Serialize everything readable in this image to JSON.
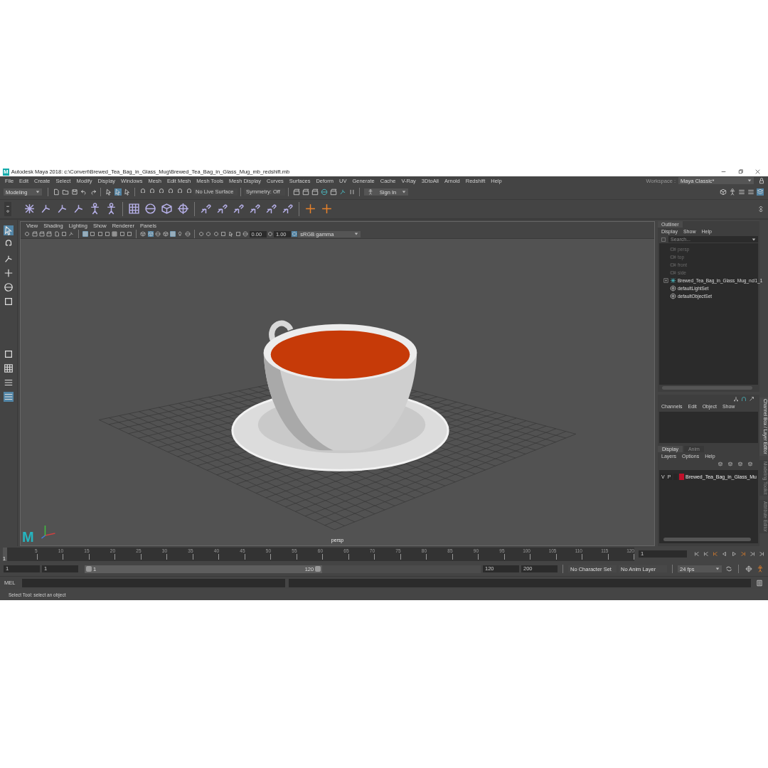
{
  "window": {
    "app_icon": "M",
    "title": "Autodesk Maya 2018: c:\\Convert\\Brewed_Tea_Bag_in_Glass_Mug\\Brewed_Tea_Bag_in_Glass_Mug_mb_redshift.mb"
  },
  "menu": [
    "File",
    "Edit",
    "Create",
    "Select",
    "Modify",
    "Display",
    "Windows",
    "Mesh",
    "Edit Mesh",
    "Mesh Tools",
    "Mesh Display",
    "Curves",
    "Surfaces",
    "Deform",
    "UV",
    "Generate",
    "Cache",
    "V-Ray",
    "3DtoAll",
    "Arnold",
    "Redshift",
    "Help"
  ],
  "workspace": {
    "label": "Workspace :",
    "value": "Maya Classic*"
  },
  "status_line": {
    "mode": "Modeling",
    "live_surface": "No Live Surface",
    "symmetry": "Symmetry: Off",
    "sign_in": "Sign In"
  },
  "viewport": {
    "menu": [
      "View",
      "Shading",
      "Lighting",
      "Show",
      "Renderer",
      "Panels"
    ],
    "exposure": "0.00",
    "gamma": "1.00",
    "color_space": "sRGB gamma",
    "camera_label": "persp",
    "logo": "M"
  },
  "outliner": {
    "title": "Outliner",
    "menu": [
      "Display",
      "Show",
      "Help"
    ],
    "search": {
      "placeholder": "Search..."
    },
    "items": [
      {
        "name": "persp",
        "kind": "camera",
        "hidden": true
      },
      {
        "name": "top",
        "kind": "camera",
        "hidden": true
      },
      {
        "name": "front",
        "kind": "camera",
        "hidden": true
      },
      {
        "name": "side",
        "kind": "camera",
        "hidden": true
      },
      {
        "name": "Brewed_Tea_Bag_in_Glass_Mug_ncl1_1",
        "kind": "group",
        "hidden": false,
        "expanded": false
      },
      {
        "name": "defaultLightSet",
        "kind": "set",
        "hidden": false
      },
      {
        "name": "defaultObjectSet",
        "kind": "set",
        "hidden": false
      }
    ]
  },
  "channel_box": {
    "menu": [
      "Channels",
      "Edit",
      "Object",
      "Show"
    ]
  },
  "layer_editor": {
    "tabs": [
      {
        "label": "Display",
        "selected": true
      },
      {
        "label": "Anim",
        "selected": false
      }
    ],
    "menu": [
      "Layers",
      "Options",
      "Help"
    ],
    "layers": [
      {
        "visible": "V",
        "playback": "P",
        "color": "#c0102a",
        "name": "Brewed_Tea_Bag_in_Glass_Mu"
      }
    ]
  },
  "side_tabs": [
    {
      "label": "Channel Box / Layer Editor",
      "selected": true
    },
    {
      "label": "Modeling Toolkit",
      "selected": false
    },
    {
      "label": "Attribute Editor",
      "selected": false
    }
  ],
  "timeline": {
    "current_frame": "1",
    "level": 0,
    "ticks": [
      "5",
      "10",
      "15",
      "20",
      "25",
      "30",
      "35",
      "40",
      "45",
      "50",
      "55",
      "60",
      "65",
      "70",
      "75",
      "80",
      "85",
      "90",
      "95",
      "100",
      "105",
      "110",
      "115",
      "120"
    ],
    "frame_field": "1"
  },
  "range": {
    "level": 0.6,
    "start": "1",
    "playback_start": "1",
    "slider_start": "1",
    "slider_end": "120",
    "playback_end": "120",
    "end": "200",
    "character_set": "No Character Set",
    "anim_layer": "No Anim Layer",
    "fps": "24 fps"
  },
  "command_line": {
    "label": "MEL"
  },
  "help_line": "Select Tool: select an object"
}
